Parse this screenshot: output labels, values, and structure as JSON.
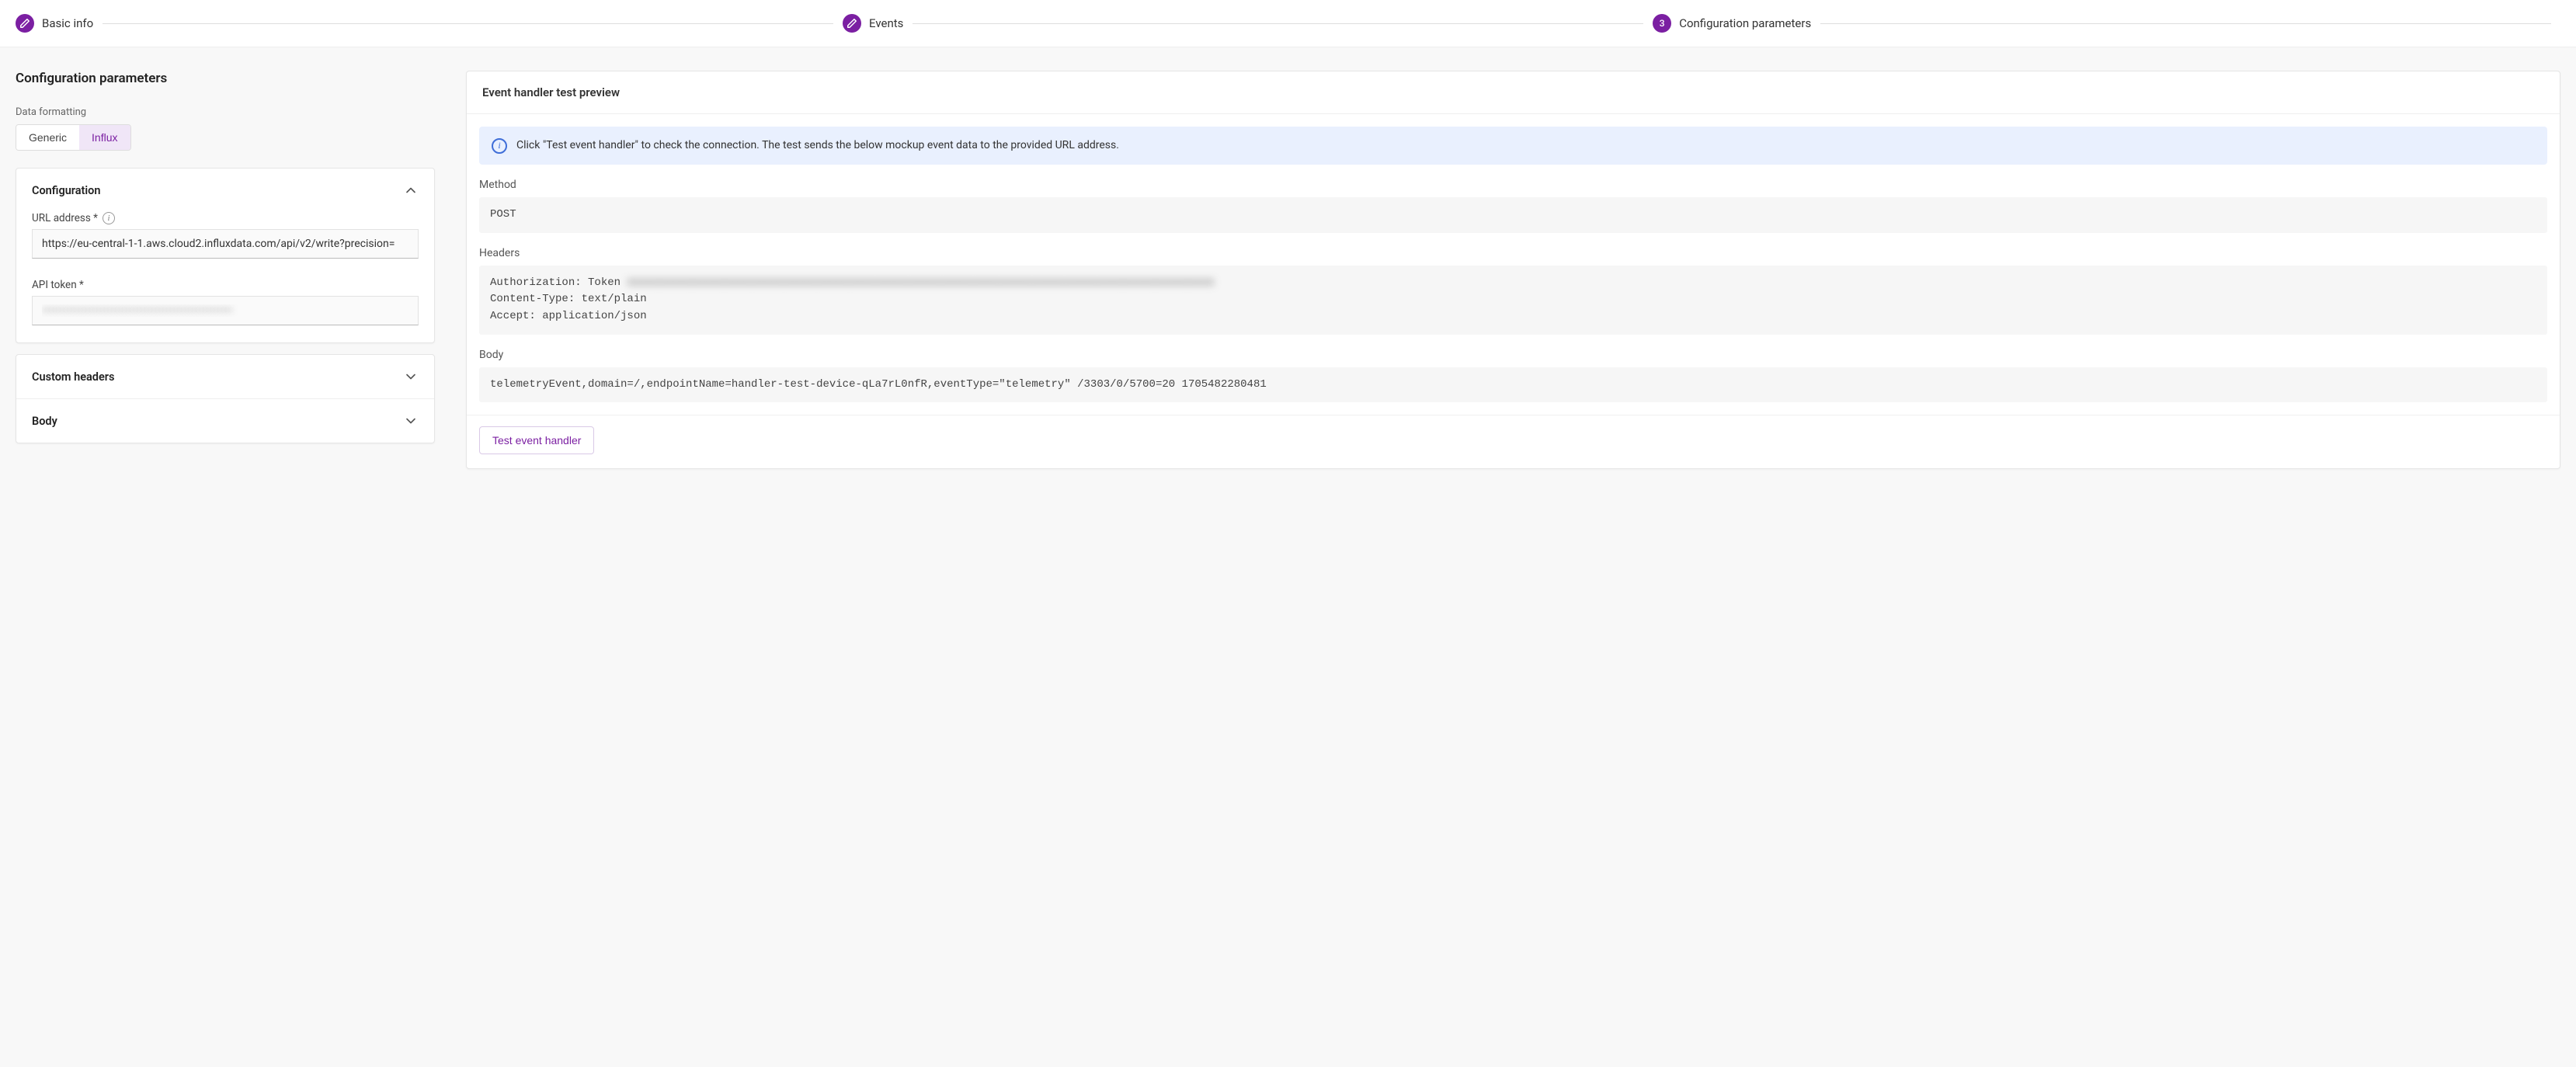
{
  "stepper": {
    "step1_label": "Basic info",
    "step2_label": "Events",
    "step3_number": "3",
    "step3_label": "Configuration parameters"
  },
  "page": {
    "title": "Configuration parameters"
  },
  "dataFormatting": {
    "label": "Data formatting",
    "option_generic": "Generic",
    "option_influx": "Influx",
    "selected": "Influx"
  },
  "configCard": {
    "title": "Configuration",
    "url_label": "URL address *",
    "url_value": "https://eu-central-1-1.aws.cloud2.influxdata.com/api/v2/write?precision=",
    "token_label": "API token *",
    "token_value": "••••••••••••••••••••••••••••••••••••••••••••••••••••"
  },
  "customHeadersCard": {
    "title": "Custom headers"
  },
  "bodyCard": {
    "title": "Body"
  },
  "preview": {
    "title": "Event handler test preview",
    "banner_text": "Click \"Test event handler\" to check the connection. The test sends the below mockup event data to the provided URL address.",
    "method_label": "Method",
    "method_value": "POST",
    "headers_label": "Headers",
    "header_auth_prefix": "Authorization: Token ",
    "header_auth_value_hidden": "xxxxxxxxxxxxxxxxxxxxxxxxxxxxxxxxxxxxxxxxxxxxxxxxxxxxxxxxxxxxxxxxxxxxxxxxxxxxxxxxxxxxxxxxxx",
    "header_content_type": "Content-Type: text/plain",
    "header_accept": "Accept: application/json",
    "body_label": "Body",
    "body_value": "telemetryEvent,domain=/,endpointName=handler-test-device-qLa7rL0nfR,eventType=\"telemetry\" /3303/0/5700=20 1705482280481",
    "test_button": "Test event handler"
  }
}
